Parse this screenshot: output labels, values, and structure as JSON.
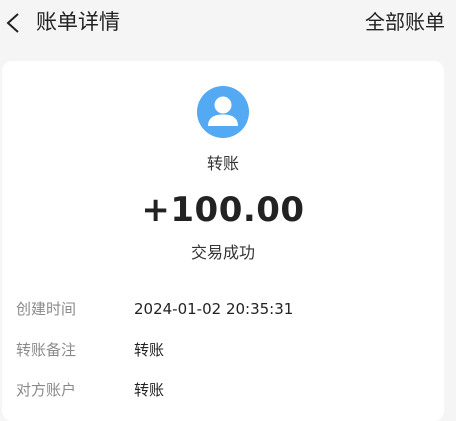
{
  "header": {
    "title": "账单详情",
    "right_link": "全部账单",
    "back_icon": "chevron-left-icon"
  },
  "detail": {
    "avatar_icon": "user-icon",
    "avatar_color": "#53a9f2",
    "type": "转账",
    "amount": "+100.00",
    "status": "交易成功",
    "rows": [
      {
        "label": "创建时间",
        "value": "2024-01-02 20:35:31"
      },
      {
        "label": "转账备注",
        "value": "转账"
      },
      {
        "label": "对方账户",
        "value": "转账"
      }
    ]
  }
}
